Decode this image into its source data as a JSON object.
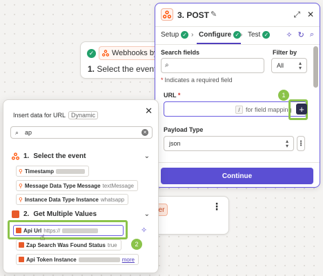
{
  "step_card": {
    "app_label": "Webhooks by Zap",
    "step_number": "1.",
    "step_title": "Select the event"
  },
  "partial_card": {
    "label_fragment": "er"
  },
  "panel": {
    "title": "3. POST",
    "tabs": [
      {
        "label": "Setup",
        "done": true
      },
      {
        "label": "Configure",
        "done": true,
        "active": true
      },
      {
        "label": "Test",
        "done": true
      }
    ],
    "search_fields_label": "Search fields",
    "filter_by_label": "Filter by",
    "filter_value": "All",
    "required_note": "Indicates a required field",
    "url_label": "URL",
    "url_placeholder": "for field mapping",
    "url_slash": "/",
    "payload_label": "Payload Type",
    "payload_value": "json",
    "continue_label": "Continue",
    "annotation_1": "1"
  },
  "popup": {
    "title": "Insert data for URL",
    "badge": "Dynamic",
    "search_value": "ap",
    "sections": [
      {
        "number": "1.",
        "title": "Select the event",
        "items": [
          {
            "label": "Timestamp",
            "value": "",
            "redacted": true
          },
          {
            "label": "Message Data Type Message",
            "value": "textMessage"
          },
          {
            "label": "Instance Data Type Instance",
            "value": "whatsapp"
          }
        ]
      },
      {
        "number": "2.",
        "title": "Get Multiple Values",
        "items": [
          {
            "label": "Api Url",
            "value": "https://",
            "redacted": true,
            "selected": true
          },
          {
            "label": "Zap Search Was Found Status",
            "value": "true"
          },
          {
            "label": "Api Token Instance",
            "value": "",
            "redacted": true,
            "more": "more"
          }
        ]
      }
    ],
    "annotation_2": "2"
  },
  "colors": {
    "accent": "#695be0",
    "button": "#5b4fd3",
    "success": "#22a06b",
    "annotation": "#8bc34a",
    "brand_orange": "#ff4f00"
  }
}
